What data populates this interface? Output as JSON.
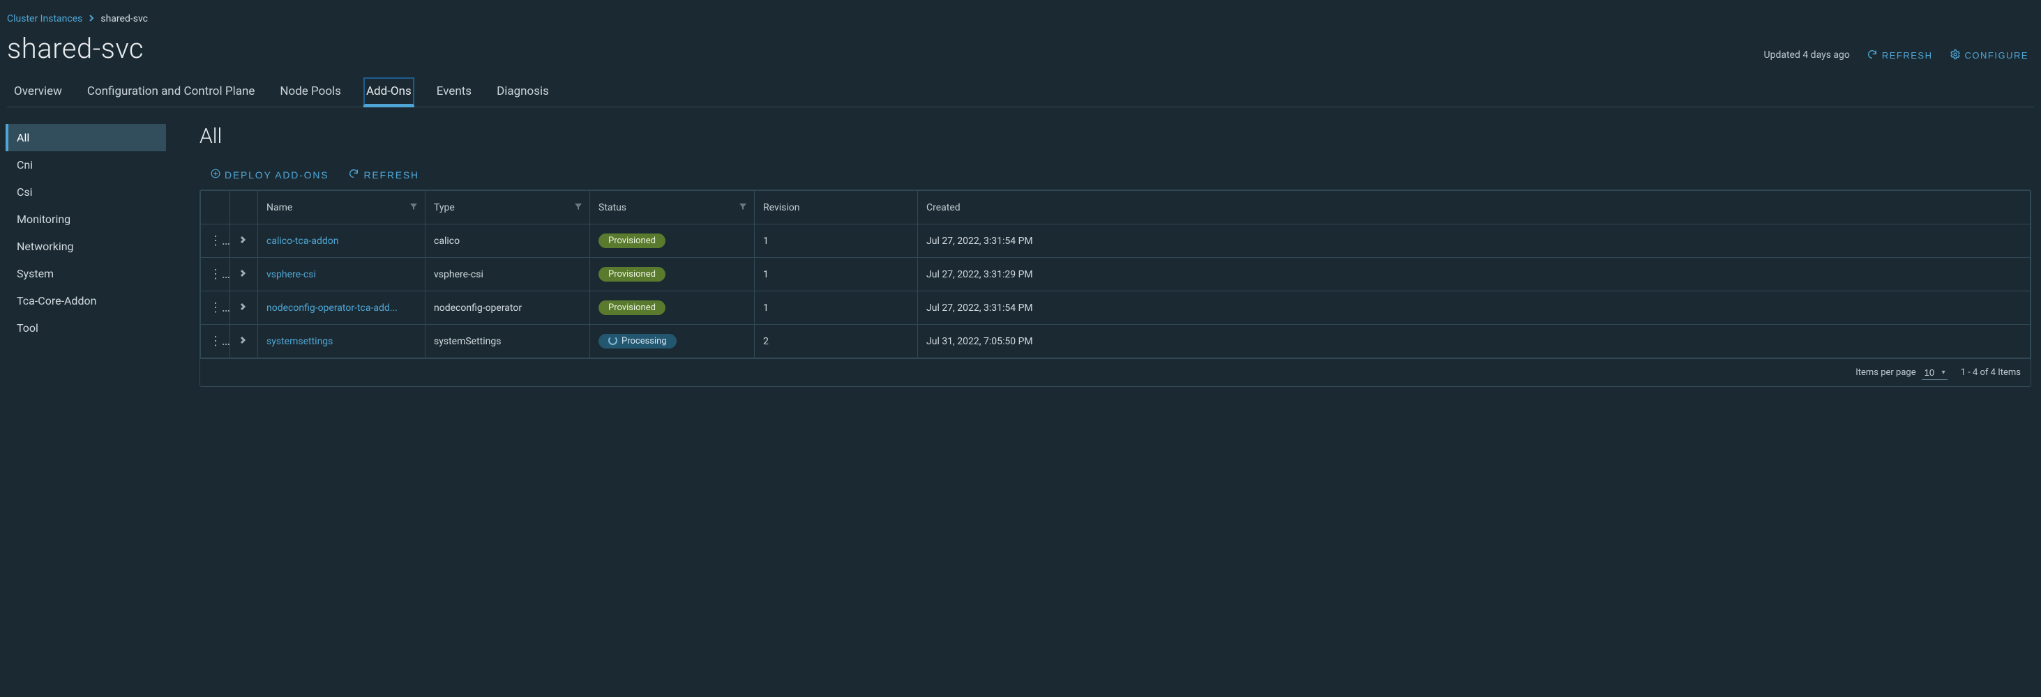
{
  "breadcrumb": {
    "root": "Cluster Instances",
    "current": "shared-svc"
  },
  "page_title": "shared-svc",
  "updated_text": "Updated 4 days ago",
  "actions": {
    "refresh": "REFRESH",
    "configure": "CONFIGURE"
  },
  "tabs": [
    "Overview",
    "Configuration and Control Plane",
    "Node Pools",
    "Add-Ons",
    "Events",
    "Diagnosis"
  ],
  "active_tab_index": 3,
  "sidebar": {
    "items": [
      "All",
      "Cni",
      "Csi",
      "Monitoring",
      "Networking",
      "System",
      "Tca-Core-Addon",
      "Tool"
    ],
    "active_index": 0
  },
  "main": {
    "heading": "All",
    "toolbar": {
      "deploy": "DEPLOY ADD-ONS",
      "refresh": "REFRESH"
    },
    "columns": {
      "name": "Name",
      "type": "Type",
      "status": "Status",
      "revision": "Revision",
      "created": "Created"
    },
    "rows": [
      {
        "name": "calico-tca-addon",
        "type": "calico",
        "status": "Provisioned",
        "status_kind": "provisioned",
        "revision": "1",
        "created": "Jul 27, 2022, 3:31:54 PM"
      },
      {
        "name": "vsphere-csi",
        "type": "vsphere-csi",
        "status": "Provisioned",
        "status_kind": "provisioned",
        "revision": "1",
        "created": "Jul 27, 2022, 3:31:29 PM"
      },
      {
        "name": "nodeconfig-operator-tca-add...",
        "type": "nodeconfig-operator",
        "status": "Provisioned",
        "status_kind": "provisioned",
        "revision": "1",
        "created": "Jul 27, 2022, 3:31:54 PM"
      },
      {
        "name": "systemsettings",
        "type": "systemSettings",
        "status": "Processing",
        "status_kind": "processing",
        "revision": "2",
        "created": "Jul 31, 2022, 7:05:50 PM"
      }
    ],
    "footer": {
      "items_per_page_label": "Items per page",
      "page_size": "10",
      "range_text": "1 - 4 of 4 Items"
    }
  }
}
